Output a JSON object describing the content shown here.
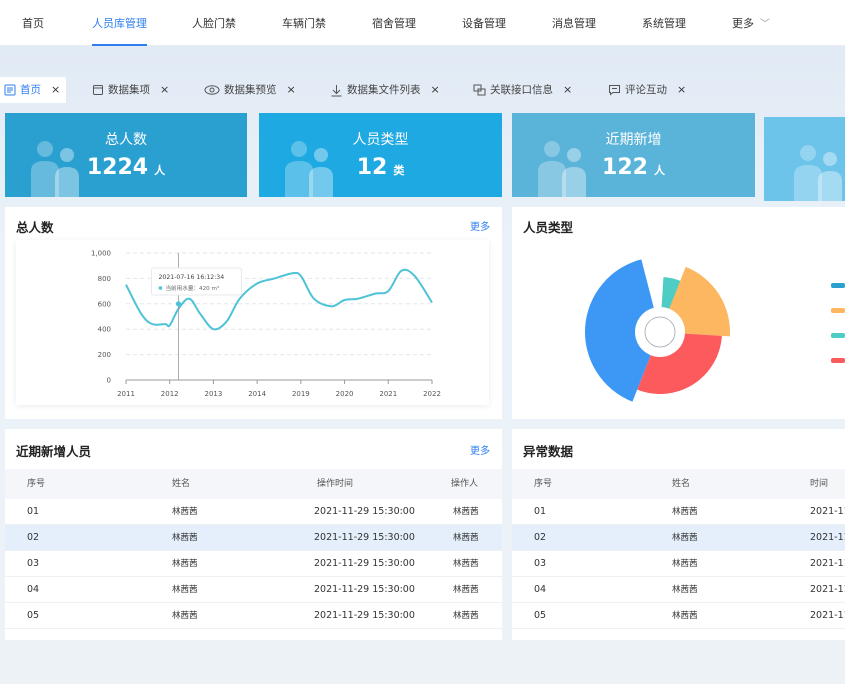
{
  "nav": {
    "items": [
      "首页",
      "人员库管理",
      "人脸门禁",
      "车辆门禁",
      "宿舍管理",
      "设备管理",
      "消息管理",
      "系统管理",
      "更多"
    ],
    "active_index": 1
  },
  "tabs": {
    "items": [
      {
        "label": "首页",
        "icon": "list-icon"
      },
      {
        "label": "数据集项",
        "icon": "folder-icon"
      },
      {
        "label": "数据集预览",
        "icon": "eye-icon"
      },
      {
        "label": "数据集文件列表",
        "icon": "download-icon"
      },
      {
        "label": "关联接口信息",
        "icon": "link-icon"
      },
      {
        "label": "评论互动",
        "icon": "comment-icon"
      }
    ],
    "close_glyph": "×"
  },
  "stats": [
    {
      "title": "总人数",
      "value": "1224",
      "unit": "人",
      "color": "#2aa0d1"
    },
    {
      "title": "人员类型",
      "value": "12",
      "unit": "类",
      "color": "#1ea9e2"
    },
    {
      "title": "近期新增",
      "value": "122",
      "unit": "人",
      "color": "#5ab3d9"
    },
    {
      "title": "",
      "value": "",
      "unit": "",
      "color": "#6cc4ea"
    }
  ],
  "panels": {
    "total": {
      "title": "总人数",
      "more": "更多"
    },
    "types": {
      "title": "人员类型"
    },
    "recent": {
      "title": "近期新增人员",
      "more": "更多"
    },
    "abnormal": {
      "title": "异常数据"
    }
  },
  "chart_data": [
    {
      "type": "line",
      "title": "",
      "xlabel": "",
      "ylabel": "",
      "x": [
        "2011",
        "2012",
        "2013",
        "2014",
        "2019",
        "2020",
        "2021",
        "2022"
      ],
      "ylim": [
        0,
        1000
      ],
      "yticks": [
        "0",
        "200",
        "400",
        "600",
        "800",
        "1,000"
      ],
      "grid": true,
      "color": "#4ec2d6",
      "points": [
        [
          0,
          750
        ],
        [
          0.35,
          520
        ],
        [
          0.6,
          440
        ],
        [
          0.9,
          440
        ],
        [
          1.0,
          430
        ],
        [
          1.2,
          560
        ],
        [
          1.45,
          640
        ],
        [
          1.7,
          520
        ],
        [
          2.0,
          400
        ],
        [
          2.3,
          460
        ],
        [
          2.6,
          640
        ],
        [
          3.0,
          760
        ],
        [
          3.4,
          800
        ],
        [
          3.8,
          840
        ],
        [
          4.0,
          820
        ],
        [
          4.3,
          640
        ],
        [
          4.7,
          580
        ],
        [
          5.0,
          630
        ],
        [
          5.3,
          640
        ],
        [
          5.7,
          680
        ],
        [
          6.0,
          700
        ],
        [
          6.3,
          860
        ],
        [
          6.6,
          820
        ],
        [
          7.0,
          610
        ]
      ],
      "tooltip": {
        "time": "2021-07-16 16:12:34",
        "label": "当前用水量：420 m³",
        "x": 1.2,
        "y": 600
      }
    },
    {
      "type": "pie",
      "title": "",
      "rose": true,
      "slices": [
        {
          "value": 30,
          "radius": 75,
          "color": "#3d98f5"
        },
        {
          "value": 20,
          "radius": 55,
          "color": "#4ecdc4"
        },
        {
          "value": 25,
          "radius": 70,
          "color": "#fdb760"
        },
        {
          "value": 25,
          "radius": 62,
          "color": "#fc5a5c"
        }
      ],
      "legend_colors": [
        "#2aa0d1",
        "#fdb760",
        "#4ecdc4",
        "#fc5a5c"
      ],
      "legend": "right"
    }
  ],
  "recent_table": {
    "headers": [
      "序号",
      "姓名",
      "操作时间",
      "操作人"
    ],
    "rows": [
      [
        "01",
        "林茜茜",
        "2021-11-29 15:30:00",
        "林茜茜"
      ],
      [
        "02",
        "林茜茜",
        "2021-11-29 15:30:00",
        "林茜茜"
      ],
      [
        "03",
        "林茜茜",
        "2021-11-29 15:30:00",
        "林茜茜"
      ],
      [
        "04",
        "林茜茜",
        "2021-11-29 15:30:00",
        "林茜茜"
      ],
      [
        "05",
        "林茜茜",
        "2021-11-29 15:30:00",
        "林茜茜"
      ]
    ],
    "highlight_row": 1
  },
  "abnormal_table": {
    "headers": [
      "序号",
      "姓名",
      "时间"
    ],
    "rows": [
      [
        "01",
        "林茜茜",
        "2021-11"
      ],
      [
        "02",
        "林茜茜",
        "2021-11"
      ],
      [
        "03",
        "林茜茜",
        "2021-11"
      ],
      [
        "04",
        "林茜茜",
        "2021-11"
      ],
      [
        "05",
        "林茜茜",
        "2021-11"
      ]
    ],
    "highlight_row": 1
  }
}
